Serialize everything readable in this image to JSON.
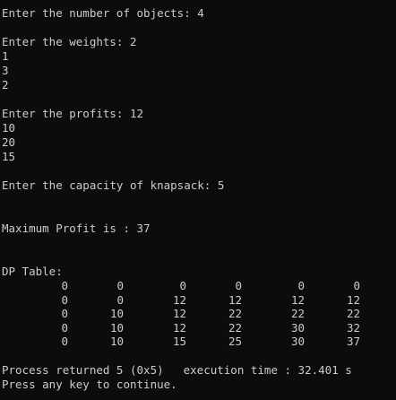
{
  "console": {
    "prompt_objects": "Enter the number of objects: 4",
    "prompt_weights": "Enter the weights: 2",
    "weights_rest": [
      "1",
      "3",
      "2"
    ],
    "prompt_profits": "Enter the profits: 12",
    "profits_rest": [
      "10",
      "20",
      "15"
    ],
    "prompt_capacity": "Enter the capacity of knapsack: 5",
    "max_profit": "Maximum Profit is : 37",
    "dp_title": "DP Table:",
    "dp_table": [
      [
        "0",
        "0",
        "0",
        "0",
        "0",
        "0"
      ],
      [
        "0",
        "0",
        "12",
        "12",
        "12",
        "12"
      ],
      [
        "0",
        "10",
        "12",
        "22",
        "22",
        "22"
      ],
      [
        "0",
        "10",
        "12",
        "22",
        "30",
        "32"
      ],
      [
        "0",
        "10",
        "15",
        "25",
        "30",
        "37"
      ]
    ],
    "process_returned": "Process returned 5 (0x5)",
    "execution_time": "execution time : 32.401 s",
    "press_any_key": "Press any key to continue."
  }
}
